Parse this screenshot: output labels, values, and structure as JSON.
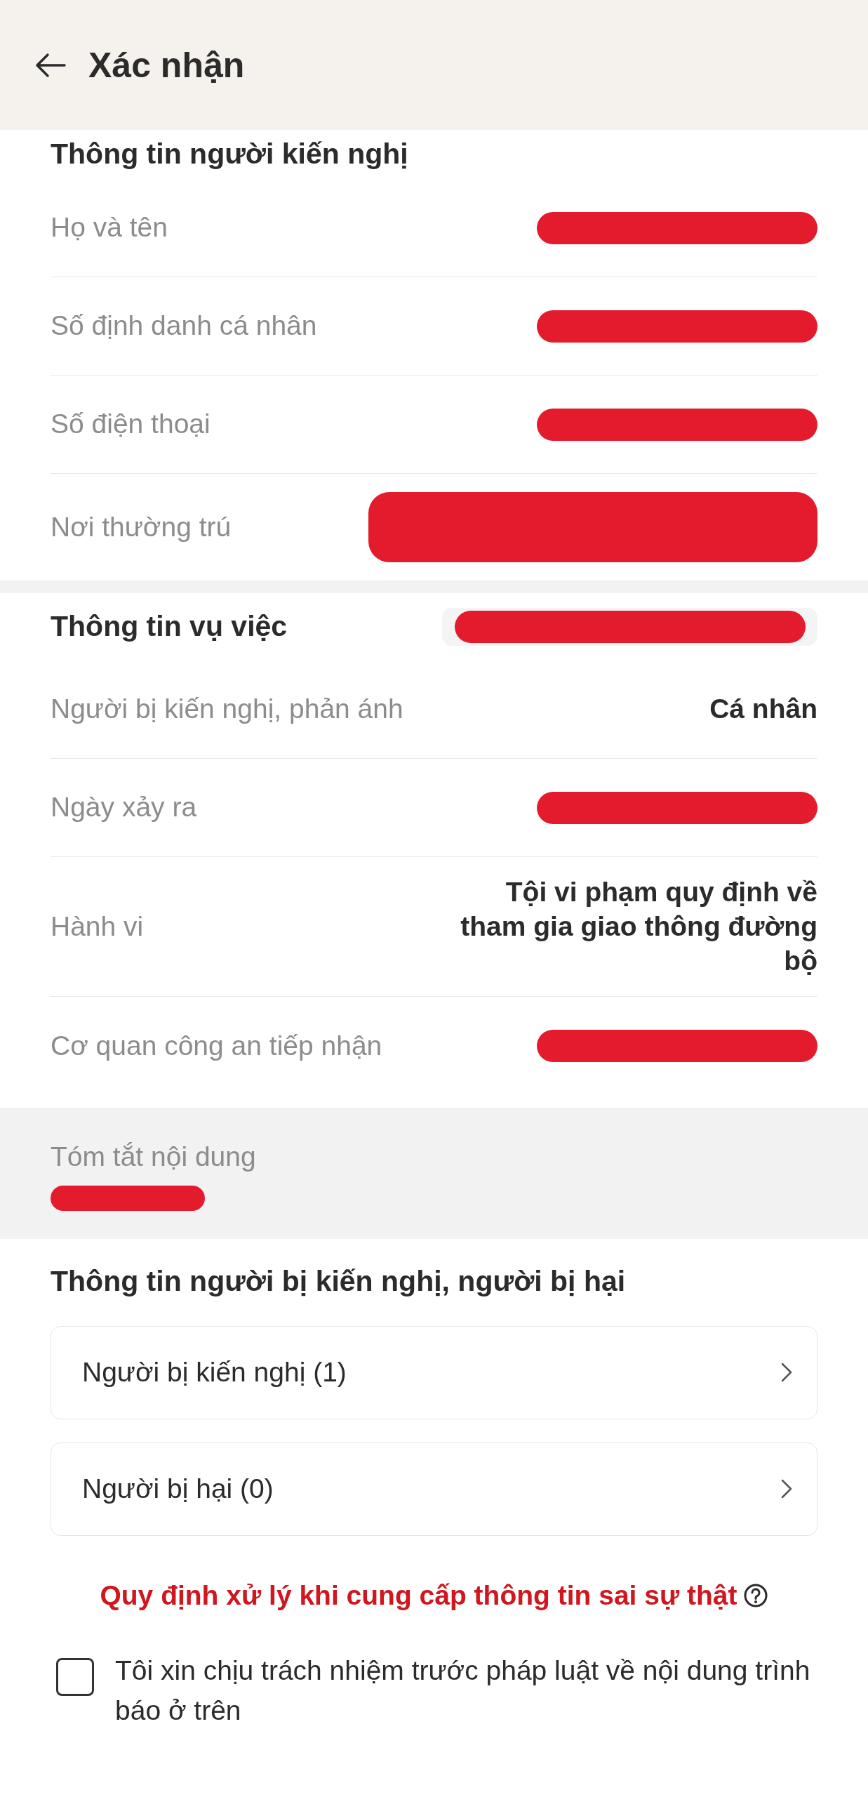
{
  "header": {
    "title": "Xác nhận"
  },
  "sections": [
    {
      "title": "Thông tin người kiến nghị",
      "rows": [
        {
          "label": "Họ và tên",
          "kind": "redacted"
        },
        {
          "label": "Số định danh cá nhân",
          "kind": "redacted"
        },
        {
          "label": "Số điện thoại",
          "kind": "redacted"
        },
        {
          "label": "Nơi thường trú",
          "kind": "redacted_block"
        }
      ]
    },
    {
      "title": "Thông tin vụ việc",
      "title_redacted": true,
      "rows": [
        {
          "label": "Người bị kiến nghị, phản ánh",
          "kind": "text",
          "value": "Cá nhân"
        },
        {
          "label": "Ngày xảy ra",
          "kind": "redacted"
        },
        {
          "label": "Hành vi",
          "kind": "text",
          "value": "Tội vi phạm quy định về tham gia giao thông đường bộ"
        },
        {
          "label": "Cơ quan công an tiếp nhận",
          "kind": "redacted"
        }
      ]
    }
  ],
  "summary": {
    "label": "Tóm tắt nội dung",
    "redacted": true
  },
  "people": {
    "title": "Thông tin người bị kiến nghị, người bị hại",
    "items": [
      {
        "label": "Người bị kiến nghị (1)"
      },
      {
        "label": "Người bị hại (0)"
      }
    ]
  },
  "notice": {
    "text": "Quy định xử lý khi cung cấp thông tin sai sự thật"
  },
  "agreement": {
    "label": "Tôi xin chịu trách nhiệm trước pháp luật về nội dung trình báo ở trên",
    "checked": false
  }
}
